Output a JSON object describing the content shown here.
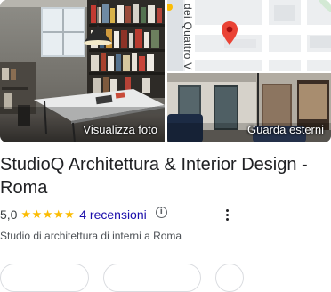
{
  "photos": {
    "main_caption": "Visualizza foto",
    "map_street": "dei Quattro V",
    "street_caption": "Guarda esterni"
  },
  "business": {
    "name_line1": "StudioQ Architettura & Interior Design -",
    "name_line2": "Roma",
    "rating": "5,0",
    "stars": "★★★★★",
    "reviews": "4 recensioni",
    "info_glyph": "i",
    "category": "Studio di architettura di interni a Roma"
  },
  "icons": {
    "pin": "map-pin-icon",
    "info": "info-icon",
    "more": "more-vert-icon"
  },
  "colors": {
    "star": "#fbbc04",
    "link": "#1a0dab",
    "pin": "#ea4335"
  }
}
